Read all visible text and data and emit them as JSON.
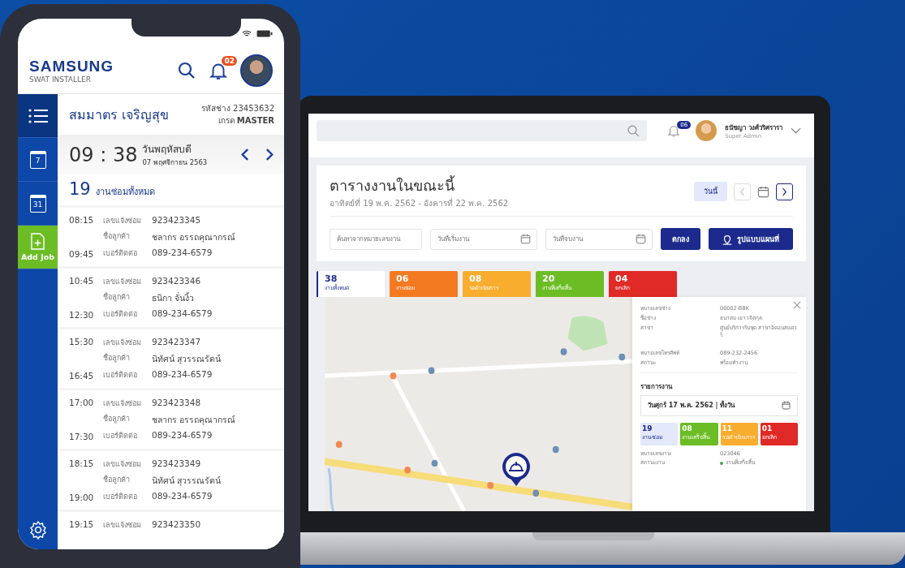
{
  "phone": {
    "header": {
      "brand": "SAMSUNG",
      "subtitle": "SWAT INSTALLER",
      "notification_count": "02"
    },
    "nav": [
      {
        "kind": "menu",
        "selected": true
      },
      {
        "kind": "calendar",
        "label": "7",
        "selected": false
      },
      {
        "kind": "calendar",
        "label": "31",
        "selected": false
      },
      {
        "kind": "add",
        "label": "Add Job",
        "selected": false
      }
    ],
    "technician": {
      "name": "สมมาตร เจริญสุข",
      "code_label": "รหัสช่าง",
      "code": "23453632",
      "grade_label": "เกรด",
      "grade": "MASTER"
    },
    "clock": {
      "time": "09 : 38",
      "day": "วันพฤหัสบดี",
      "date": "07 พฤศจิกายน 2563"
    },
    "summary": {
      "count": "19",
      "label": "งานซ่อมทั้งหมด"
    },
    "jobs": [
      {
        "start": "08:15",
        "end": "09:45",
        "fields": [
          {
            "label": "เลขแจ้งซ่อม",
            "value": "923423345"
          },
          {
            "label": "ชื่อลูกค้า",
            "value": "ชลากร อรรถคุณากรณ์"
          },
          {
            "label": "เบอร์ติดต่อ",
            "value": "089-234-6579"
          }
        ]
      },
      {
        "start": "10:45",
        "end": "12:30",
        "fields": [
          {
            "label": "เลขแจ้งซ่อม",
            "value": "923423346"
          },
          {
            "label": "ชื่อลูกค้า",
            "value": "ธนิกา จั่นงิ้ว"
          },
          {
            "label": "เบอร์ติดต่อ",
            "value": "089-234-6579"
          }
        ]
      },
      {
        "start": "15:30",
        "end": "16:45",
        "fields": [
          {
            "label": "เลขแจ้งซ่อม",
            "value": "923423347"
          },
          {
            "label": "ชื่อลูกค้า",
            "value": "นิทัศน์ สุวรรณรัตน์"
          },
          {
            "label": "เบอร์ติดต่อ",
            "value": "089-234-6579"
          }
        ]
      },
      {
        "start": "17:00",
        "end": "17:30",
        "fields": [
          {
            "label": "เลขแจ้งซ่อม",
            "value": "923423348"
          },
          {
            "label": "ชื่อลูกค้า",
            "value": "ชลากร อรรถคุณากรณ์"
          },
          {
            "label": "เบอร์ติดต่อ",
            "value": "089-234-6579"
          }
        ]
      },
      {
        "start": "18:15",
        "end": "19:00",
        "fields": [
          {
            "label": "เลขแจ้งซ่อม",
            "value": "923423349"
          },
          {
            "label": "ชื่อลูกค้า",
            "value": "นิทัศน์ สุวรรณรัตน์"
          },
          {
            "label": "เบอร์ติดต่อ",
            "value": "089-234-6579"
          }
        ]
      },
      {
        "start": "19:15",
        "fields": [
          {
            "label": "เลขแจ้งซ่อม",
            "value": "923423350"
          }
        ]
      }
    ]
  },
  "laptop": {
    "topbar": {
      "notification_count": "06",
      "user_name": "ธนัชญา วงศ์วริศรารา",
      "role": "Super Admin"
    },
    "schedule": {
      "title": "ตารางงานในขณะนี้",
      "range": "อาทิตย์ที่ 19 พ.ค. 2562 - อังคารที่ 22 พ.ค. 2562",
      "today_button": "วันนี้"
    },
    "filters": {
      "search_placeholder": "ค้นหาจากหมายเลขงาน",
      "start_placeholder": "วันที่เริ่มงาน",
      "end_placeholder": "วันที่จบงาน",
      "ok_button": "ตกลง",
      "map_button": "รูปแบบแผนที่"
    },
    "status_tabs": [
      {
        "count": "38",
        "label": "งานทั้งหมด",
        "color": "#ffffff",
        "selected": true
      },
      {
        "count": "06",
        "label": "งานซ่อม",
        "color": "#f47a22",
        "selected": false
      },
      {
        "count": "08",
        "label": "รอดำเนินการ",
        "color": "#f9ad2e",
        "selected": false
      },
      {
        "count": "20",
        "label": "งานที่เสร็จสิ้น",
        "color": "#6cbd25",
        "selected": false
      },
      {
        "count": "04",
        "label": "ยกเลิก",
        "color": "#df2a26",
        "selected": false
      }
    ],
    "detail": {
      "info": [
        {
          "label": "หมายเลขช่าง",
          "value": "00002-BBK"
        },
        {
          "label": "ชื่อช่าง",
          "value": "ธนาคม เยาวจิตกุล"
        },
        {
          "label": "สาขา",
          "value": "ศูนย์บริการรับชุด สาขาอิคอนสแควร์"
        },
        {
          "label": "หมายเลขโทรศัพท์",
          "value": "089-232-2456"
        },
        {
          "label": "สถานะ",
          "value": "พร้อมทำงาน"
        }
      ],
      "section_title": "รายการงาน",
      "date_value": "วันศุกร์ 17 พ.ค. 2562 | ทั้งวัน",
      "stats": [
        {
          "count": "19",
          "label": "งานซ่อม",
          "color": "#e3e8fb"
        },
        {
          "count": "08",
          "label": "งานเสร็จสิ้น",
          "color": "#6cbd25"
        },
        {
          "count": "11",
          "label": "รอดำเนินการ",
          "color": "#f9ad2e"
        },
        {
          "count": "01",
          "label": "ยกเลิก",
          "color": "#df2a26"
        }
      ],
      "job": [
        {
          "label": "หมายเลขงาน",
          "value": "023046"
        },
        {
          "label": "สถานะงาน",
          "value": "งานที่เสร็จสิ้น",
          "color": "#3cb043"
        }
      ]
    }
  }
}
